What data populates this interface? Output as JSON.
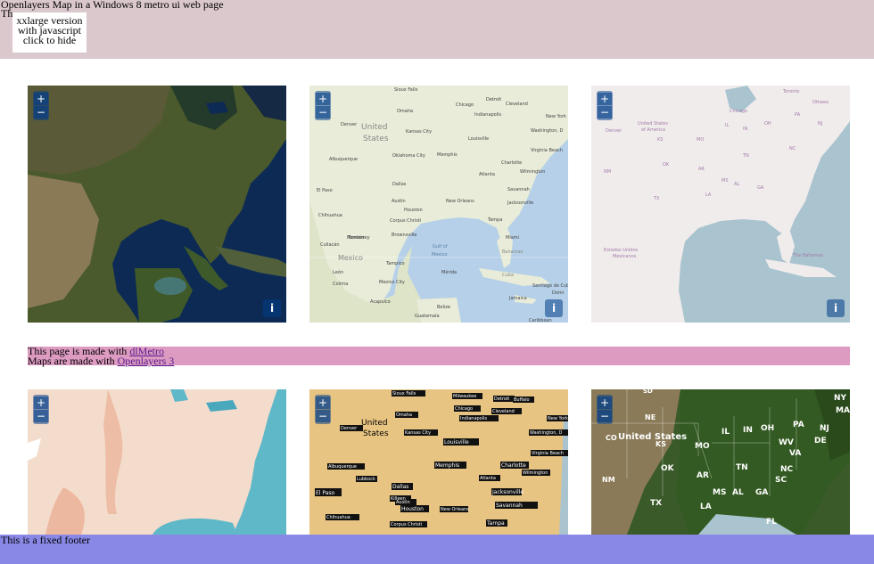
{
  "header": {
    "title": "Openlayers Map in a Windows 8 metro ui web page",
    "subtitle_fragment": "Th"
  },
  "popup": {
    "line1": "xxlarge version",
    "line2": "with javascript",
    "line3": "click to hide"
  },
  "maps": [
    {
      "name": "satellite",
      "zoom_in": "+",
      "zoom_out": "−",
      "info": "i"
    },
    {
      "name": "mapquest-osm",
      "zoom_in": "+",
      "zoom_out": "−",
      "info": "i",
      "labels": [
        "Sioux Falls",
        "Detroit",
        "Chicago",
        "Cleveland",
        "Omaha",
        "Indianapolis",
        "New York",
        "Denver",
        "United States",
        "Kansas City",
        "Washington, D",
        "Louisville",
        "Albuquerque",
        "Oklahoma City",
        "Memphis",
        "Charlotte",
        "Virginia Beach",
        "Atlanta",
        "Wilmington",
        "El Paso",
        "Dallas",
        "Jacksonville",
        "Chihuahua",
        "Austin",
        "New Orleans",
        "Houston",
        "Savannah",
        "Corpus Christi",
        "Tampa",
        "Monterrey",
        "Miami",
        "Gulf of Mexico",
        "Culiacán",
        "Brownsville",
        "Mexico",
        "Bahamas",
        "Tampico",
        "León",
        "Mérida",
        "Cuba",
        "Mexico City",
        "Acapulco",
        "Belize",
        "Guatemala",
        "Jamaica",
        "Santiago de Cuba",
        "Domi",
        "Colima",
        "Caribbean",
        "Torreón"
      ]
    },
    {
      "name": "osm-light",
      "zoom_in": "+",
      "zoom_out": "−",
      "info": "i",
      "labels": [
        "Toronto",
        "United States of America",
        "Chicago",
        "Ottawa",
        "Denver",
        "KS",
        "MO",
        "IL",
        "IN",
        "OH",
        "PA",
        "NJ",
        "OK",
        "AR",
        "TN",
        "NC",
        "TX",
        "LA",
        "MS",
        "AL",
        "GA",
        "NM",
        "Estados Unidos Mexicanos",
        "The Bahamas"
      ]
    },
    {
      "name": "watercolor",
      "zoom_in": "+",
      "zoom_out": "−"
    },
    {
      "name": "toner-gold",
      "zoom_in": "+",
      "zoom_out": "−",
      "labels": [
        "Sioux Falls",
        "Milwaukee",
        "Detroit",
        "Buffalo",
        "Chicago",
        "Cleveland",
        "Omaha",
        "Indianapolis",
        "New York",
        "Denver",
        "United States",
        "Kansas City",
        "Washington, D",
        "Louisville",
        "Virginia Beach",
        "Albuquerque",
        "Memphis",
        "Charlotte",
        "Wilmington",
        "Lubbock",
        "Atlanta",
        "El Paso",
        "Dallas",
        "Jacksonville",
        "Killeen",
        "Savannah",
        "Austin",
        "Houston",
        "New Orleans",
        "Chihuahua",
        "Corpus Christi",
        "Tampa"
      ]
    },
    {
      "name": "satellite-labels",
      "zoom_in": "+",
      "zoom_out": "−",
      "labels": [
        "SD",
        "NE",
        "CO",
        "United States",
        "KS",
        "MO",
        "IL",
        "IN",
        "OH",
        "PA",
        "NJ",
        "WV",
        "VA",
        "DE",
        "NM",
        "OK",
        "AR",
        "TN",
        "NC",
        "TX",
        "LA",
        "MS",
        "AL",
        "GA",
        "SC",
        "FL",
        "NY",
        "MA"
      ]
    }
  ],
  "credits": {
    "line1_prefix": "This page is made with ",
    "line1_link": "dlMetro",
    "line2_prefix": "Maps are made with ",
    "line2_link": "Openlayers 3"
  },
  "footer": {
    "text": "This is a fixed footer"
  },
  "colors": {
    "header_bg": "#dbc8cd",
    "credits_bg": "#dd9bc2",
    "footer_bg": "#8a88e6",
    "link": "#551a8b"
  }
}
